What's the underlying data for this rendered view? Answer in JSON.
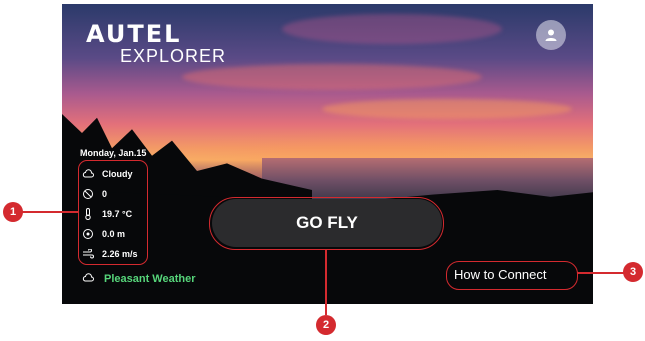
{
  "brand": {
    "logo_text": "AUTEL",
    "subtitle": "EXPLORER"
  },
  "user": {
    "icon": "user-icon"
  },
  "weather": {
    "date": "Monday, Jan.15",
    "rows": [
      {
        "icon": "cloud-icon",
        "value": "Cloudy"
      },
      {
        "icon": "no-fly-icon",
        "value": "0"
      },
      {
        "icon": "thermometer-icon",
        "value": "19.7 °C"
      },
      {
        "icon": "visibility-icon",
        "value": "0.0 m"
      },
      {
        "icon": "wind-icon",
        "value": "2.26 m/s"
      }
    ],
    "summary_icon": "cloud-icon",
    "summary": "Pleasant Weather"
  },
  "actions": {
    "go_fly": "GO FLY",
    "how_to_connect": "How to Connect"
  },
  "callouts": [
    "1",
    "2",
    "3"
  ],
  "colors": {
    "callout": "#d42a2f",
    "pleasant": "#56d57a",
    "go_fly_bg": "#2b2b2d"
  }
}
